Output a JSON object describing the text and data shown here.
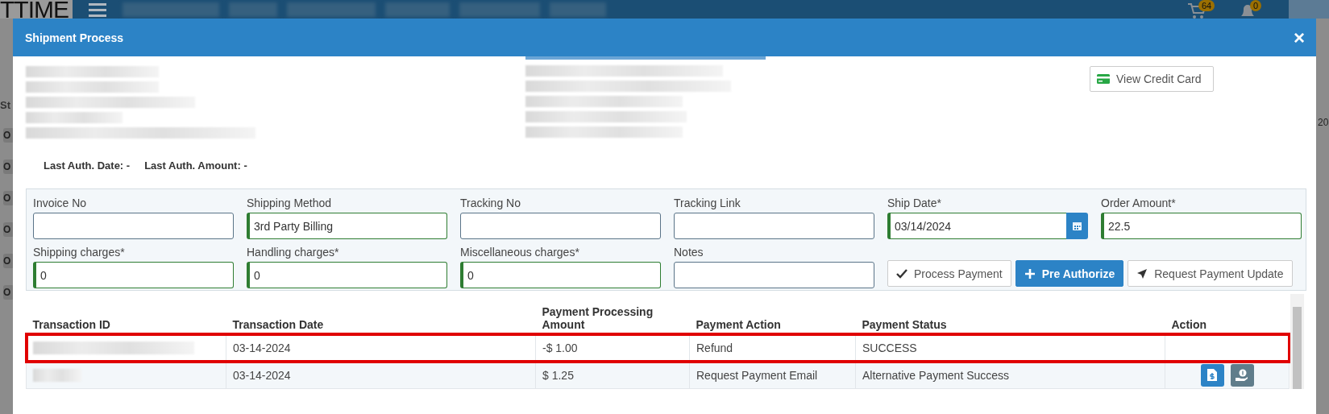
{
  "app_bar": {
    "logo": "TTIME",
    "cart_count": "64",
    "notification_count": "0"
  },
  "page_behind": {
    "column_header": "St",
    "edge_text": "20",
    "row_chips": [
      "O",
      "O",
      "O",
      "O",
      "O",
      "O"
    ]
  },
  "modal": {
    "title": "Shipment Process",
    "close": "×",
    "view_credit_card": "View Credit Card",
    "auth_info": [
      "Last Auth. Date: -",
      "Last Auth. Amount: -"
    ],
    "fields": [
      {
        "label": "Invoice No",
        "validated": false,
        "kind": "text"
      },
      {
        "label": "Shipping Method",
        "value": "3rd Party Billing",
        "validated": true,
        "kind": "text"
      },
      {
        "label": "Tracking No",
        "validated": false,
        "kind": "text"
      },
      {
        "label": "Tracking Link",
        "validated": false,
        "kind": "text"
      },
      {
        "label": "Ship Date*",
        "value": "03/14/2024",
        "validated": true,
        "kind": "date"
      },
      {
        "label": "Order Amount*",
        "value": "22.5",
        "validated": true,
        "kind": "text"
      },
      {
        "label": "Shipping charges*",
        "value": "0",
        "validated": true,
        "kind": "text"
      },
      {
        "label": "Handling charges*",
        "value": "0",
        "validated": true,
        "kind": "text"
      },
      {
        "label": "Miscellaneous charges*",
        "value": "0",
        "validated": true,
        "kind": "text"
      },
      {
        "label": "Notes",
        "validated": false,
        "kind": "text"
      }
    ],
    "buttons": [
      {
        "label": "Process Payment",
        "kind": "default"
      },
      {
        "label": "Pre Authorize",
        "kind": "primary"
      },
      {
        "label": "Request Payment Update",
        "kind": "default"
      }
    ],
    "table": {
      "columns": [
        "Transaction ID",
        "Transaction Date",
        "Payment Processing Amount",
        "Payment Action",
        "Payment Status",
        "Action"
      ],
      "rows": [
        {
          "date": "03-14-2024",
          "amount": "-$ 1.00",
          "action": "Refund",
          "status": "SUCCESS",
          "highlighted": true,
          "show_actions": false
        },
        {
          "date": "03-14-2024",
          "amount": "$ 1.25",
          "action": "Request Payment Email",
          "status": "Alternative Payment Success",
          "highlighted": false,
          "show_actions": true
        }
      ]
    }
  }
}
